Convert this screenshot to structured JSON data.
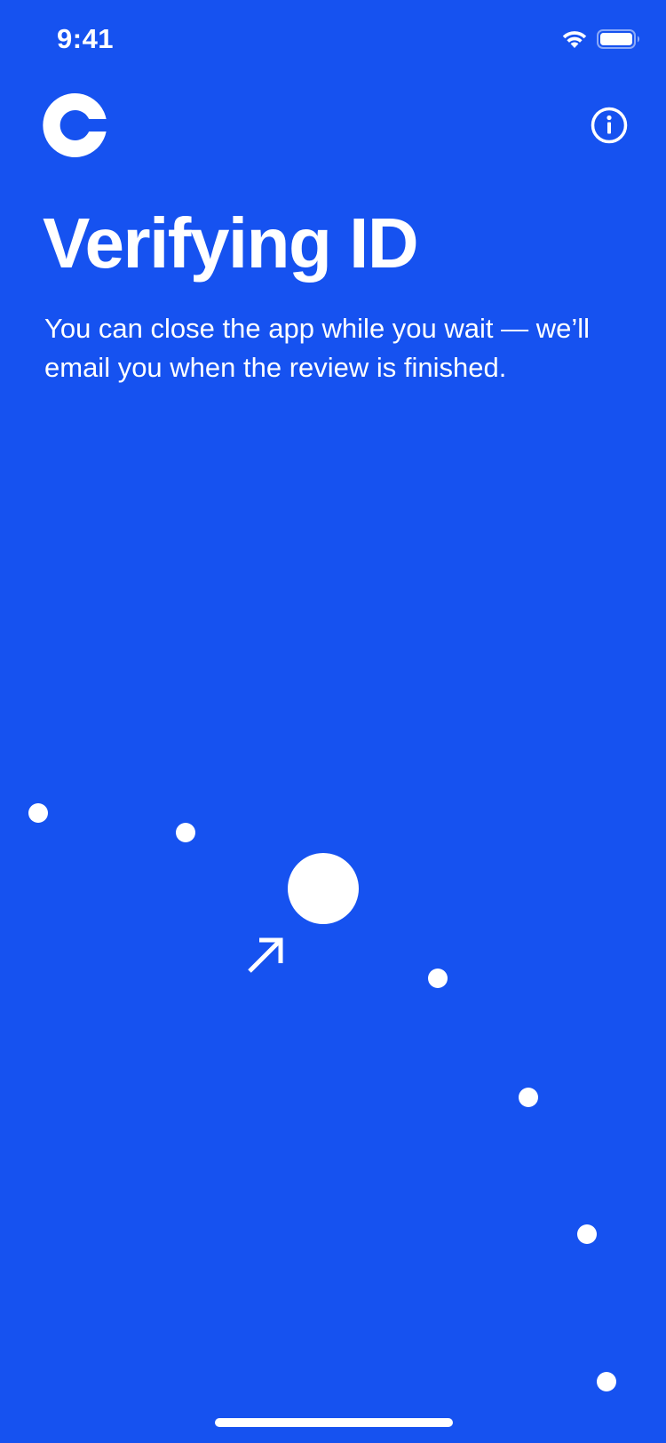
{
  "status_bar": {
    "time": "9:41",
    "wifi_icon": "wifi-icon",
    "battery_icon": "battery-icon"
  },
  "header": {
    "logo_icon": "coinbase-logo-icon",
    "info_icon": "info-icon"
  },
  "main": {
    "title": "Verifying ID",
    "subtitle": "You can close the app while you wait — we’ll email you when the review is finished."
  },
  "illustration": {
    "center_icon": "arrow-up-right-icon"
  },
  "colors": {
    "background": "#1652F0",
    "foreground": "#FFFFFF"
  }
}
